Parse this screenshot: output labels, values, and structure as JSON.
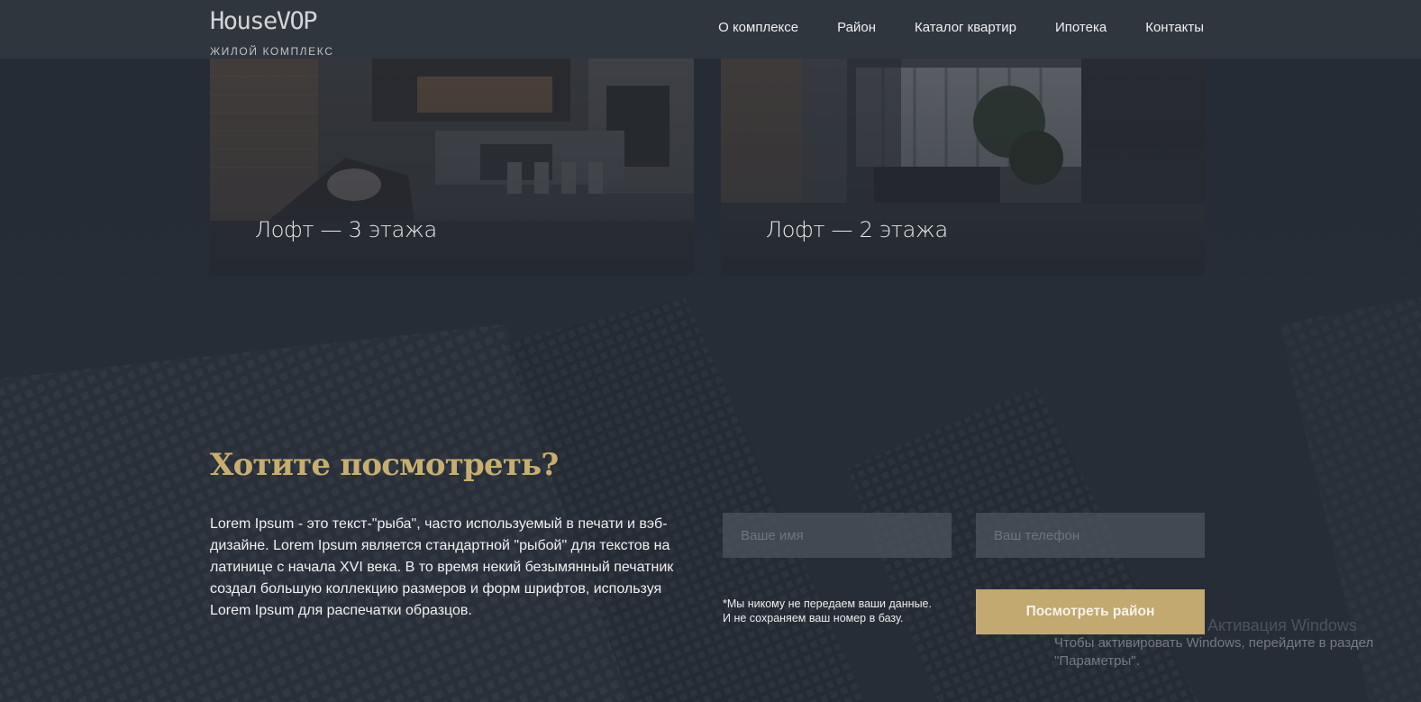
{
  "header": {
    "logo": {
      "name": "HouseVOP",
      "subtitle": "ЖИЛОЙ КОМПЛЕКС"
    },
    "nav": [
      {
        "label": "О комплексе"
      },
      {
        "label": "Район"
      },
      {
        "label": "Каталог квартир"
      },
      {
        "label": "Ипотека"
      },
      {
        "label": "Контакты"
      }
    ]
  },
  "cards": [
    {
      "title": "Лофт — 3 этажа"
    },
    {
      "title": "Лофт — 2 этажа"
    }
  ],
  "cta": {
    "title": "Хотите посмотреть?",
    "text": "Lorem Ipsum - это текст-\"рыба\", часто используемый в печати и вэб-дизайне. Lorem Ipsum является стандартной \"рыбой\" для текстов на латинице с начала XVI века. В то время некий безымянный печатник создал большую коллекцию размеров и форм шрифтов, используя Lorem Ipsum для распечатки образцов.",
    "name_placeholder": "Ваше имя",
    "phone_placeholder": "Ваш телефон",
    "privacy_line1": "*Мы никому не передаем ваши данные.",
    "privacy_line2": "И не сохраняем ваш номер в базу.",
    "button_label": "Посмотреть район"
  },
  "watermark": {
    "title": "Активация Windows",
    "line1": "Чтобы активировать Windows, перейдите в раздел",
    "line2": "\"Параметры\"."
  },
  "colors": {
    "accent": "#c7ad70",
    "button": "#c1a96f",
    "background": "#262c35",
    "header": "#313740"
  }
}
